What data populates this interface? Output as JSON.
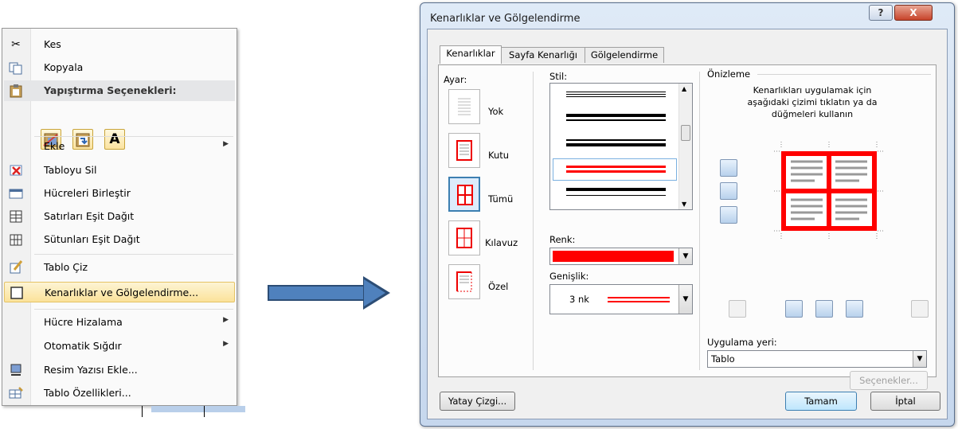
{
  "context_menu": {
    "items": [
      {
        "label": "Kes",
        "icon": "scissors-icon"
      },
      {
        "label": "Kopyala",
        "icon": "copy-icon"
      },
      {
        "label": "Yapıştırma Seçenekleri:",
        "icon": "clipboard-icon"
      },
      {
        "label": "Ekle",
        "has_submenu": true
      },
      {
        "label": "Tabloyu Sil",
        "icon": "delete-table-icon"
      },
      {
        "label": "Hücreleri Birleştir",
        "icon": "merge-cells-icon"
      },
      {
        "label": "Satırları Eşit Dağıt",
        "icon": "distribute-rows-icon"
      },
      {
        "label": "Sütunları Eşit Dağıt",
        "icon": "distribute-columns-icon"
      },
      {
        "label": "Tablo Çiz",
        "icon": "draw-table-icon"
      },
      {
        "label": "Kenarlıklar ve Gölgelendirme...",
        "icon": "borders-icon",
        "highlighted": true
      },
      {
        "label": "Hücre Hizalama",
        "has_submenu": true
      },
      {
        "label": "Otomatik Sığdır",
        "has_submenu": true
      },
      {
        "label": "Resim Yazısı Ekle...",
        "icon": "caption-icon"
      },
      {
        "label": "Tablo Özellikleri...",
        "icon": "table-properties-icon"
      }
    ],
    "paste_option_letter": "A",
    "submenu_arrow": "▶"
  },
  "dialog": {
    "title": "Kenarlıklar ve Gölgelendirme",
    "help_glyph": "?",
    "close_glyph": "X",
    "tabs": [
      "Kenarlıklar",
      "Sayfa Kenarlığı",
      "Gölgelendirme"
    ],
    "active_tab": 0,
    "setting": {
      "label": "Ayar:",
      "options": [
        "Yok",
        "Kutu",
        "Tümü",
        "Kılavuz",
        "Özel"
      ],
      "selected": "Tümü"
    },
    "style": {
      "label": "Stil:",
      "selected_color": "#ff0000"
    },
    "color": {
      "label": "Renk:",
      "value_color": "#ff0000"
    },
    "width": {
      "label": "Genişlik:",
      "value": "3 nk"
    },
    "preview": {
      "label": "Önizleme",
      "instructions": "Kenarlıkları uygulamak için aşağıdaki çizimi tıklatın ya da düğmeleri kullanın",
      "border_color": "#ff0000"
    },
    "apply_to": {
      "label": "Uygulama yeri:",
      "value": "Tablo"
    },
    "options_button": "Seçenekler...",
    "horizontal_line_button": "Yatay Çizgi...",
    "ok_button": "Tamam",
    "cancel_button": "İptal",
    "dropdown_glyph": "▼",
    "scroll_up_glyph": "▲",
    "scroll_down_glyph": "▼"
  }
}
